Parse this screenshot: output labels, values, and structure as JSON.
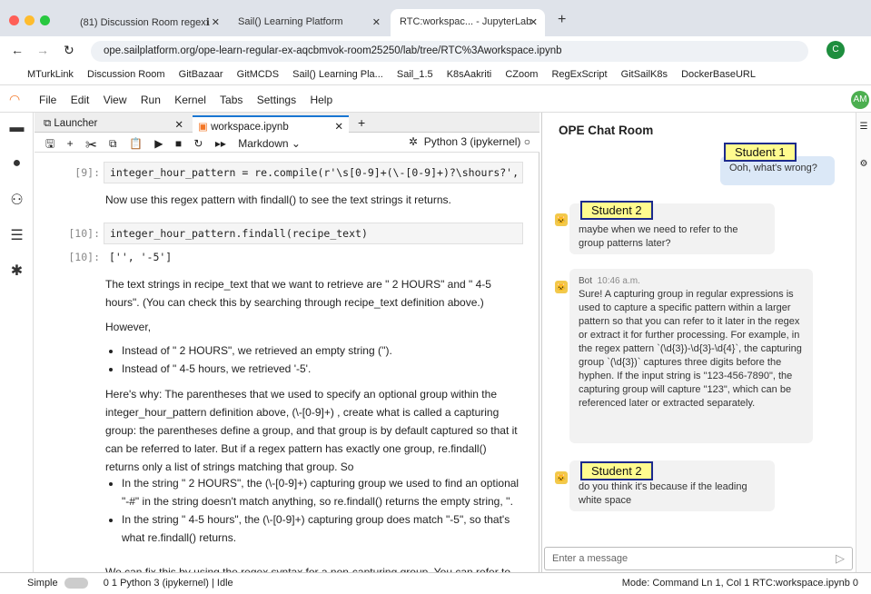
{
  "browser": {
    "tabs": [
      "(81) Discussion Room regexℹ",
      "Sail() Learning Platform",
      "RTC:workspac... - JupyterLab"
    ],
    "url": "ope.sailplatform.org/ope-learn-regular-ex-aqcbmvok-room25250/lab/tree/RTC%3Aworkspace.ipynb",
    "bookmarks": [
      "MTurkLink",
      "Discussion Room",
      "GitBazaar",
      "GitMCDS",
      "Sail() Learning Pla...",
      "Sail_1.5",
      "K8sAakriti",
      "CZoom",
      "RegExScript",
      "GitSailK8s",
      "DockerBaseURL"
    ],
    "avatar": "AM"
  },
  "menu": [
    "File",
    "Edit",
    "View",
    "Run",
    "Kernel",
    "Tabs",
    "Settings",
    "Help"
  ],
  "notebook": {
    "tabs": [
      "Launcher",
      "workspace.ipynb"
    ],
    "cell_type": "Markdown",
    "kernel": "Python 3 (ipykernel)",
    "p9": "[9]:",
    "code9": "integer_hour_pattern = re.compile(r'\\s[0-9]+(\\-[0-9]+)?\\shours?', re.IGNOR",
    "md1": "Now use this regex pattern with findall() to see the text strings it returns.",
    "p10": "[10]:",
    "code10": "integer_hour_pattern.findall(recipe_text)",
    "out10_prompt": "[10]:",
    "out10": "['', '-5']",
    "md2": "The text strings in recipe_text that we want to retrieve are \" 2 HOURS\" and \" 4-5 hours\". (You can check this by searching through recipe_text definition above.)",
    "md3": "However,",
    "bullets1": [
      "Instead of \" 2 HOURS\", we retrieved an empty string ('').",
      "Instead of \" 4-5 hours, we retrieved '-5'."
    ],
    "md4": "Here's why: The parentheses that we used to specify an optional group within the integer_hour_pattern definition above, (\\-[0-9]+) , create what is called a capturing group: the parentheses define a group, and that group is by default captured so that it can be referred to later. But if a regex pattern has exactly one group, re.findall() returns only a list of strings matching that group. So",
    "bullets2": [
      "In the string \" 2 HOURS\", the (\\-[0-9]+) capturing group we used to find an optional \"-#\" in the string doesn't match anything, so re.findall() returns the empty string, ''.",
      "In the string \" 4-5 hours\", the (\\-[0-9]+) capturing group does match \"-5\", so that's what re.findall() returns."
    ],
    "md5": "We can fix this by using the regex syntax for a non-capturing group. You can refer to"
  },
  "chat": {
    "title": "OPE Chat Room",
    "messages": [
      {
        "tag": "Student 1",
        "text": "Ooh, what's wrong?"
      },
      {
        "tag": "Student 2",
        "text": "maybe when we need to refer to the group patterns later?"
      },
      {
        "sender": "Bot",
        "time": "10:46 a.m.",
        "text": "Sure! A capturing group in regular expressions is used to capture a specific pattern within a larger pattern so that you can refer to it later in the regex or extract it for further processing. For example, in the regex pattern `(\\d{3})-\\d{3}-\\d{4}`, the capturing group `(\\d{3})` captures three digits before the hyphen. If the input string is \"123-456-7890\", the capturing group will capture \"123\", which can be referenced later or extracted separately."
      },
      {
        "tag": "Student 2",
        "text": "do you think it's because if the leading white space"
      }
    ],
    "input_placeholder": "Enter a message"
  },
  "status": {
    "mode_label": "Simple",
    "left": "0   1   Python 3 (ipykernel) | Idle",
    "right": "Mode: Command     Ln 1, Col 1   RTC:workspace.ipynb   0"
  }
}
